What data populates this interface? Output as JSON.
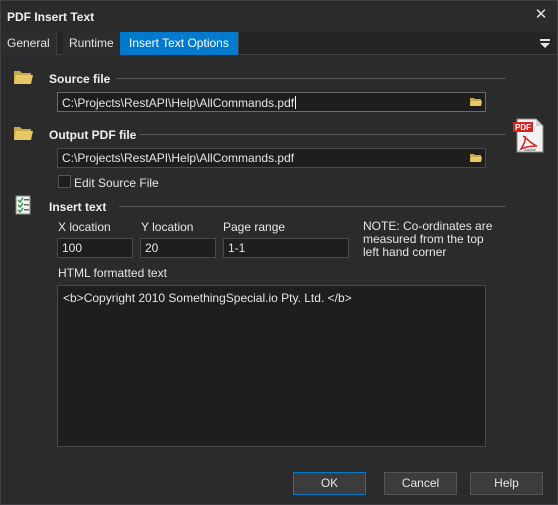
{
  "window": {
    "title": "PDF Insert Text"
  },
  "tabs": [
    {
      "label": "General"
    },
    {
      "label": "Runtime"
    },
    {
      "label": "Insert Text Options",
      "active": true
    }
  ],
  "source": {
    "label": "Source file",
    "path": "C:\\Projects\\RestAPI\\Help\\AllCommands.pdf"
  },
  "output": {
    "label": "Output PDF file",
    "path": "C:\\Projects\\RestAPI\\Help\\AllCommands.pdf",
    "edit_source_label": "Edit Source File",
    "edit_source_checked": false
  },
  "insert": {
    "label": "Insert text",
    "x_label": "X location",
    "x_value": "100",
    "y_label": "Y location",
    "y_value": "20",
    "range_label": "Page range",
    "range_value": "1-1",
    "note": "NOTE: Co-ordinates are measured from the top left hand corner",
    "html_label": "HTML formatted text",
    "html_value": "<b>Copyright 2010 SomethingSpecial.io Pty. Ltd. </b>"
  },
  "pdf_logo_text": "PDF",
  "pdf_logo_sub": "Adobe",
  "buttons": {
    "ok": "OK",
    "cancel": "Cancel",
    "help": "Help"
  },
  "colors": {
    "accent": "#007acc",
    "background": "#2b2b2b",
    "field": "#1e1e1e"
  }
}
